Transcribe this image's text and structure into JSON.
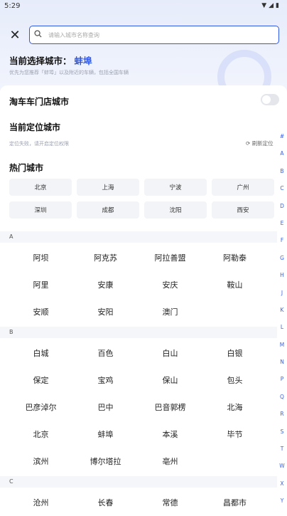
{
  "status_bar": {
    "time": "5:29",
    "system_icons": "▼◢▮"
  },
  "header": {
    "close_icon": "close-icon",
    "search_placeholder": "请输入城市名称查询",
    "current_label": "当前选择城市：",
    "current_city": "蚌埠",
    "current_tip": "优先为您推荐「蚌埠」以及附近的车辆，包括全国车辆"
  },
  "store_city": {
    "label": "淘车车门店城市",
    "enabled": false
  },
  "location": {
    "title": "当前定位城市",
    "tip": "定位失败，请开启定位权限",
    "refresh_label": "刷新定位"
  },
  "hot": {
    "title": "热门城市",
    "cities": [
      "北京",
      "上海",
      "宁波",
      "广州",
      "深圳",
      "成都",
      "沈阳",
      "西安"
    ]
  },
  "sections": [
    {
      "letter": "A",
      "cities": [
        "阿坝",
        "阿克苏",
        "阿拉善盟",
        "阿勒泰",
        "阿里",
        "安康",
        "安庆",
        "鞍山",
        "安顺",
        "安阳",
        "澳门"
      ]
    },
    {
      "letter": "B",
      "cities": [
        "白城",
        "百色",
        "白山",
        "白银",
        "保定",
        "宝鸡",
        "保山",
        "包头",
        "巴彦淖尔",
        "巴中",
        "巴音郭楞",
        "北海",
        "北京",
        "蚌埠",
        "本溪",
        "毕节",
        "滨州",
        "博尔塔拉",
        "亳州"
      ]
    },
    {
      "letter": "C",
      "cities": [
        "沧州",
        "长春",
        "常德",
        "昌都市"
      ]
    }
  ],
  "index_letters": [
    "#",
    "A",
    "B",
    "C",
    "D",
    "E",
    "F",
    "G",
    "H",
    "J",
    "K",
    "L",
    "M",
    "N",
    "P",
    "Q",
    "R",
    "S",
    "T",
    "W",
    "X",
    "Y"
  ],
  "colors": {
    "accent": "#2f57e8",
    "section_bg": "#f5f6f9",
    "hot_bg": "#f3f4f7"
  }
}
